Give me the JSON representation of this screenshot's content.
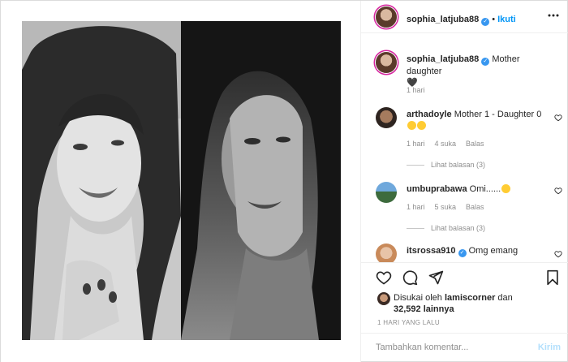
{
  "header": {
    "username": "sophia_latjuba88",
    "separator": "•",
    "follow_label": "Ikuti",
    "verified": true
  },
  "caption": {
    "username": "sophia_latjuba88",
    "text": "Mother daughter",
    "emoji": "🖤",
    "time": "1 hari"
  },
  "comments": [
    {
      "username": "arthadoyle",
      "text": "Mother 1 - Daughter 0",
      "time": "1 hari",
      "likes": "4 suka",
      "reply_label": "Balas",
      "view_replies": "Lihat balasan (3)"
    },
    {
      "username": "umbuprabawa",
      "text": "Omi......",
      "time": "1 hari",
      "likes": "5 suka",
      "reply_label": "Balas",
      "view_replies": "Lihat balasan (3)"
    },
    {
      "username": "itsrossa910",
      "text": "Omg emang",
      "verified": true
    }
  ],
  "likes": {
    "prefix": "Disukai oleh",
    "user": "lamiscorner",
    "suffix": "dan",
    "count_text": "32,592 lainnya"
  },
  "timestamp": "1 HARI YANG LALU",
  "composer": {
    "placeholder": "Tambahkan komentar...",
    "send_label": "Kirim"
  },
  "icons": {
    "like": "heart-icon",
    "comment": "comment-icon",
    "share": "share-icon",
    "save": "bookmark-icon"
  },
  "colors": {
    "accent": "#0095f6",
    "verified": "#3897f0",
    "muted": "#8e8e8e",
    "border": "#efefef"
  }
}
